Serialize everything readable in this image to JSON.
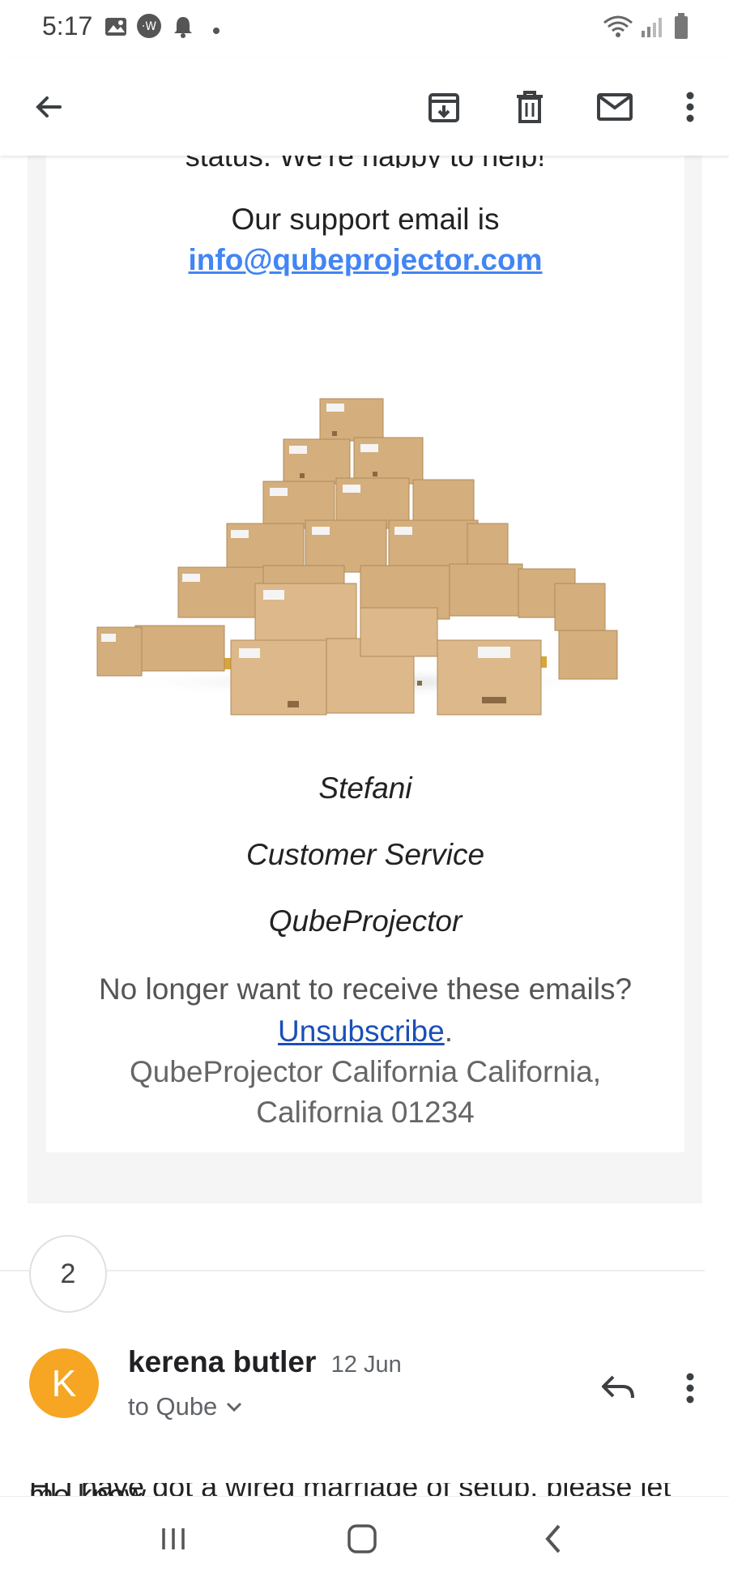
{
  "status_bar": {
    "time": "5:17",
    "icons_left": [
      "image-icon",
      "w-app-icon",
      "bell-icon",
      "dot-icon"
    ],
    "icons_right": [
      "wifi-icon",
      "signal-icon",
      "battery-icon"
    ]
  },
  "toolbar": {
    "actions": [
      "back-icon",
      "archive-icon",
      "delete-icon",
      "mark-unread-icon",
      "more-vert-icon"
    ]
  },
  "email": {
    "clipped_line": "status. We're happy to help!",
    "support_text": "Our support email is",
    "support_email": "info@qubeprojector.com",
    "image_alt": "boxes-image",
    "signature": {
      "name": "Stefani",
      "role": "Customer Service",
      "company": "QubeProjector"
    },
    "footer": {
      "question": "No longer want to receive these emails?",
      "unsubscribe": "Unsubscribe",
      "period": ".",
      "address_line1": "QubeProjector California California,",
      "address_line2": "California 01234"
    }
  },
  "thread": {
    "collapsed_count": "2"
  },
  "message": {
    "avatar_letter": "K",
    "avatar_color": "#f6a623",
    "sender_name": "kerena butler",
    "date": "12 Jun",
    "to_line": "to Qube",
    "body_peek": "Hi I have got a wired marriage of setup, please let me know"
  },
  "nav_bar": {
    "buttons": [
      "recents-icon",
      "home-icon",
      "back-nav-icon"
    ]
  }
}
